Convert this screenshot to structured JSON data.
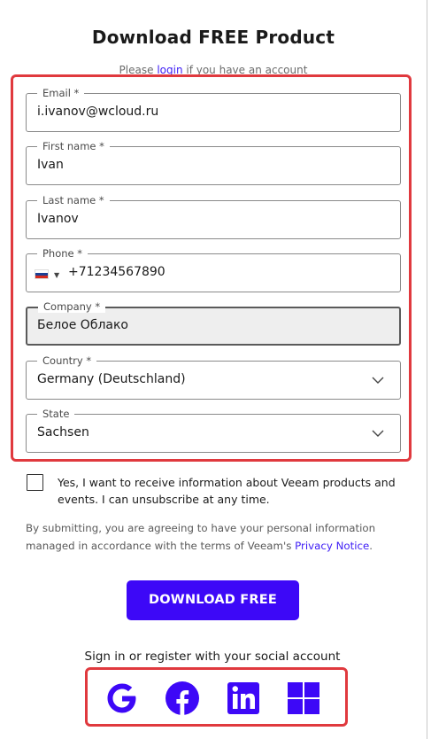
{
  "page": {
    "title": "Download FREE Product",
    "login_prefix": "Please ",
    "login_link": "login",
    "login_suffix": " if you have an account"
  },
  "form": {
    "email": {
      "label": "Email *",
      "value": "i.ivanov@wcloud.ru"
    },
    "first_name": {
      "label": "First name *",
      "value": "Ivan"
    },
    "last_name": {
      "label": "Last name *",
      "value": "Ivanov"
    },
    "phone": {
      "label": "Phone *",
      "value": "+71234567890",
      "country_flag": "russia-flag-icon"
    },
    "company": {
      "label": "Company *",
      "value": "Белое Облако"
    },
    "country": {
      "label": "Country *",
      "value": "Germany (Deutschland)"
    },
    "state": {
      "label": "State",
      "value": "Sachsen"
    }
  },
  "consent": {
    "checked": false,
    "text": "Yes, I want to receive information about Veeam products and events. I can unsubscribe at any time."
  },
  "submit_note": {
    "text": "By submitting, you are agreeing to have your personal information managed in accordance with the terms of Veeam's ",
    "link": "Privacy Notice",
    "suffix": "."
  },
  "download_button": "DOWNLOAD FREE",
  "social": {
    "heading": "Sign in or register with your social account",
    "providers": [
      "google-icon",
      "facebook-icon",
      "linkedin-icon",
      "microsoft-icon"
    ]
  },
  "colors": {
    "accent": "#3d08f7",
    "link": "#3d1cf5",
    "highlight": "#e0393e"
  }
}
